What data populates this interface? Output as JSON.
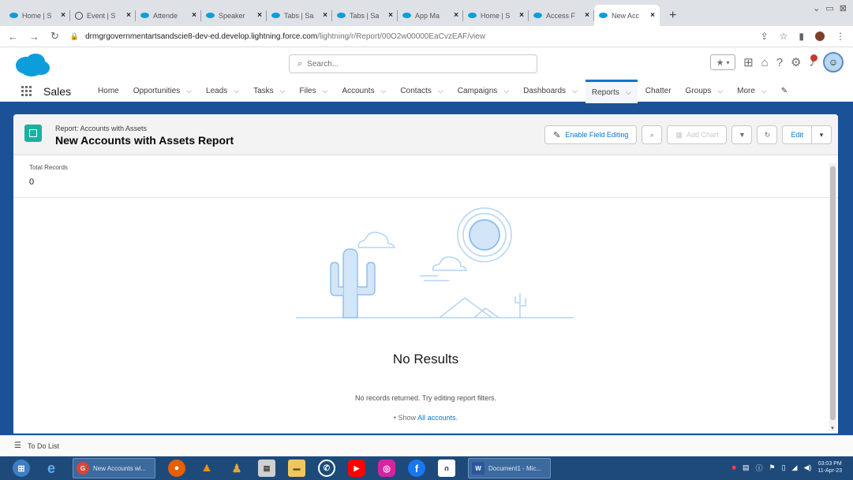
{
  "browser": {
    "tabs": [
      {
        "label": "Home | S",
        "icon": "salesforce-favicon"
      },
      {
        "label": "Event | S",
        "icon": "globe-favicon"
      },
      {
        "label": "Attende",
        "icon": "salesforce-favicon"
      },
      {
        "label": "Speaker",
        "icon": "salesforce-favicon"
      },
      {
        "label": "Tabs | Sa",
        "icon": "salesforce-favicon"
      },
      {
        "label": "Tabs | Sa",
        "icon": "salesforce-favicon"
      },
      {
        "label": "App Ma",
        "icon": "salesforce-favicon"
      },
      {
        "label": "Home | S",
        "icon": "salesforce-favicon"
      },
      {
        "label": "Access F",
        "icon": "salesforce-favicon"
      },
      {
        "label": "New Acc",
        "icon": "salesforce-favicon",
        "active": true
      }
    ],
    "close_glyph": "×",
    "new_tab_glyph": "+",
    "url_host": "drmgrgovernmentartsandscie8-dev-ed.develop.lightning.force.com",
    "url_path": "/lightning/r/Report/00O2w00000EaCvzEAF/view"
  },
  "header": {
    "search_placeholder": "Search..."
  },
  "nav": {
    "app_name": "Sales",
    "items": [
      {
        "label": "Home",
        "chevron": false
      },
      {
        "label": "Opportunities",
        "chevron": true
      },
      {
        "label": "Leads",
        "chevron": true
      },
      {
        "label": "Tasks",
        "chevron": true
      },
      {
        "label": "Files",
        "chevron": true
      },
      {
        "label": "Accounts",
        "chevron": true
      },
      {
        "label": "Contacts",
        "chevron": true
      },
      {
        "label": "Campaigns",
        "chevron": true
      },
      {
        "label": "Dashboards",
        "chevron": true
      },
      {
        "label": "Reports",
        "chevron": true,
        "active": true
      },
      {
        "label": "Chatter",
        "chevron": false
      },
      {
        "label": "Groups",
        "chevron": true
      },
      {
        "label": "More",
        "chevron": true
      }
    ]
  },
  "report": {
    "type_label": "Report: Accounts with Assets",
    "title": "New Accounts with Assets Report",
    "enable_field_editing": "Enable Field Editing",
    "add_chart": "Add Chart",
    "edit": "Edit",
    "total_records_label": "Total Records",
    "total_records_value": "0",
    "empty_title": "No Results",
    "empty_subtitle": "No records returned. Try editing report filters.",
    "show_prefix": "• Show",
    "show_link": "All accounts."
  },
  "utility_bar": {
    "todo_label": "To Do List"
  },
  "taskbar": {
    "chrome_task": "New Accounts wi...",
    "word_task": "Document1 - Mic...",
    "time": "03:03 PM",
    "date": "11-Apr-23"
  },
  "colors": {
    "brand_blue": "#0176d3",
    "nav_band": "#1b5297",
    "report_icon": "#19b1a0"
  }
}
